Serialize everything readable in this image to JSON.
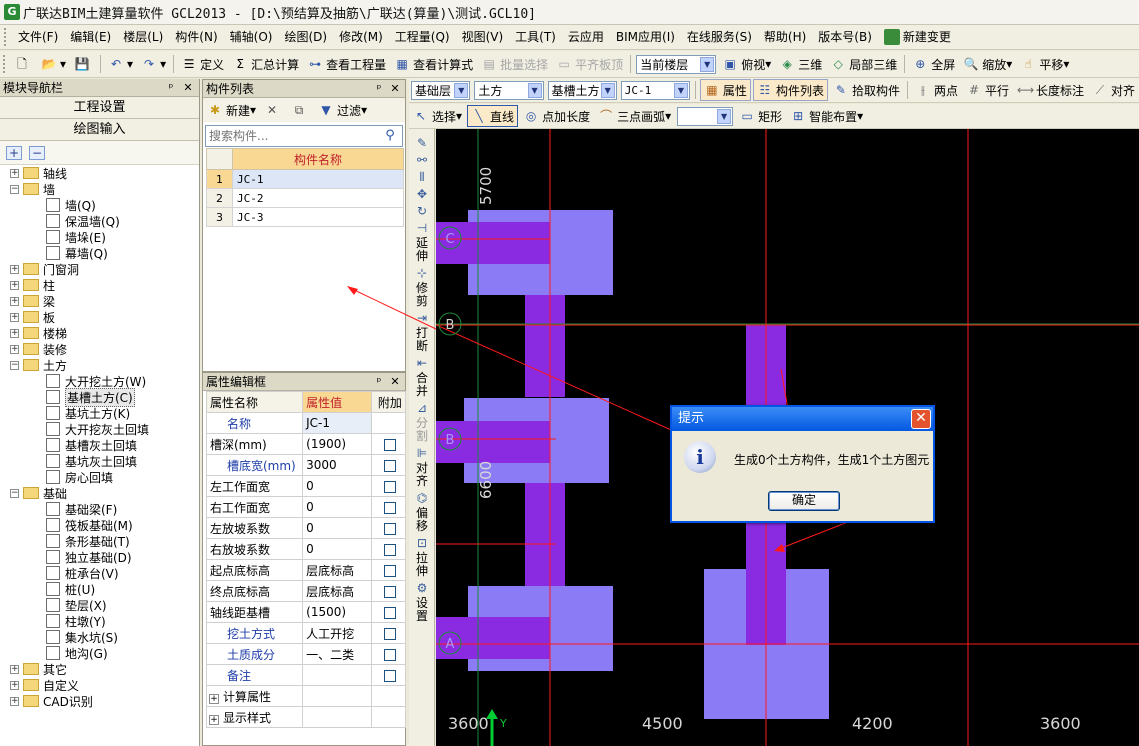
{
  "window": {
    "title": "广联达BIM土建算量软件 GCL2013 - [D:\\预结算及抽筋\\广联达(算量)\\测试.GCL10]"
  },
  "menu": [
    "文件(F)",
    "编辑(E)",
    "楼层(L)",
    "构件(N)",
    "辅轴(O)",
    "绘图(D)",
    "修改(M)",
    "工程量(Q)",
    "视图(V)",
    "工具(T)",
    "云应用",
    "BIM应用(I)",
    "在线服务(S)",
    "帮助(H)",
    "版本号(B)",
    "新建变更"
  ],
  "toolbar1": {
    "define": "定义",
    "summary": "汇总计算",
    "view_qty": "查看工程量",
    "view_formula": "查看计算式",
    "batch_select": "批量选择",
    "flat_top": "平齐板顶",
    "floor_select": "当前楼层",
    "view_mode": "俯视",
    "three_d": "三维",
    "local_3d": "局部三维",
    "fullscreen": "全屏",
    "zoom": "缩放",
    "pan": "平移"
  },
  "toolbar2": {
    "layer": "基础层",
    "type": "土方",
    "subtype": "基槽土方",
    "component": "JC-1",
    "props": "属性",
    "comp_list": "构件列表",
    "pick": "拾取构件",
    "two_point": "两点",
    "parallel": "平行",
    "length_dim": "长度标注",
    "align": "对齐"
  },
  "toolbar3": {
    "select": "选择",
    "line": "直线",
    "point_len": "点加长度",
    "arc3": "三点画弧",
    "rect": "矩形",
    "smart": "智能布置"
  },
  "nav": {
    "title": "模块导航栏",
    "project_setup": "工程设置",
    "drawing_input": "绘图输入",
    "tree": [
      {
        "label": "轴线",
        "level": 0,
        "kind": "folder",
        "exp": "+"
      },
      {
        "label": "墙",
        "level": 0,
        "kind": "folder",
        "exp": "-"
      },
      {
        "label": "墙(Q)",
        "level": 1,
        "kind": "leaf"
      },
      {
        "label": "保温墙(Q)",
        "level": 1,
        "kind": "leaf"
      },
      {
        "label": "墙垛(E)",
        "level": 1,
        "kind": "leaf"
      },
      {
        "label": "幕墙(Q)",
        "level": 1,
        "kind": "leaf"
      },
      {
        "label": "门窗洞",
        "level": 0,
        "kind": "folder",
        "exp": "+"
      },
      {
        "label": "柱",
        "level": 0,
        "kind": "folder",
        "exp": "+"
      },
      {
        "label": "梁",
        "level": 0,
        "kind": "folder",
        "exp": "+"
      },
      {
        "label": "板",
        "level": 0,
        "kind": "folder",
        "exp": "+"
      },
      {
        "label": "楼梯",
        "level": 0,
        "kind": "folder",
        "exp": "+"
      },
      {
        "label": "装修",
        "level": 0,
        "kind": "folder",
        "exp": "+"
      },
      {
        "label": "土方",
        "level": 0,
        "kind": "folder",
        "exp": "-"
      },
      {
        "label": "大开挖土方(W)",
        "level": 1,
        "kind": "leaf"
      },
      {
        "label": "基槽土方(C)",
        "level": 1,
        "kind": "leaf",
        "selected": true
      },
      {
        "label": "基坑土方(K)",
        "level": 1,
        "kind": "leaf"
      },
      {
        "label": "大开挖灰土回填",
        "level": 1,
        "kind": "leaf"
      },
      {
        "label": "基槽灰土回填",
        "level": 1,
        "kind": "leaf"
      },
      {
        "label": "基坑灰土回填",
        "level": 1,
        "kind": "leaf"
      },
      {
        "label": "房心回填",
        "level": 1,
        "kind": "leaf"
      },
      {
        "label": "基础",
        "level": 0,
        "kind": "folder",
        "exp": "-"
      },
      {
        "label": "基础梁(F)",
        "level": 1,
        "kind": "leaf"
      },
      {
        "label": "筏板基础(M)",
        "level": 1,
        "kind": "leaf"
      },
      {
        "label": "条形基础(T)",
        "level": 1,
        "kind": "leaf"
      },
      {
        "label": "独立基础(D)",
        "level": 1,
        "kind": "leaf"
      },
      {
        "label": "桩承台(V)",
        "level": 1,
        "kind": "leaf"
      },
      {
        "label": "桩(U)",
        "level": 1,
        "kind": "leaf"
      },
      {
        "label": "垫层(X)",
        "level": 1,
        "kind": "leaf"
      },
      {
        "label": "柱墩(Y)",
        "level": 1,
        "kind": "leaf"
      },
      {
        "label": "集水坑(S)",
        "level": 1,
        "kind": "leaf"
      },
      {
        "label": "地沟(G)",
        "level": 1,
        "kind": "leaf"
      },
      {
        "label": "其它",
        "level": 0,
        "kind": "folder",
        "exp": "+"
      },
      {
        "label": "自定义",
        "level": 0,
        "kind": "folder",
        "exp": "+"
      },
      {
        "label": "CAD识别",
        "level": 0,
        "kind": "folder",
        "exp": "+"
      }
    ]
  },
  "plist": {
    "title": "构件列表",
    "new": "新建",
    "filter": "过滤",
    "search_placeholder": "搜索构件...",
    "col": "构件名称",
    "rows": [
      {
        "n": "1",
        "name": "JC-1"
      },
      {
        "n": "2",
        "name": "JC-2"
      },
      {
        "n": "3",
        "name": "JC-3"
      }
    ]
  },
  "props": {
    "title": "属性编辑框",
    "headers": {
      "name": "属性名称",
      "value": "属性值",
      "extra": "附加"
    },
    "rows": [
      {
        "k": "名称",
        "v": "JC-1",
        "blue": true,
        "cb": false
      },
      {
        "k": "槽深(mm)",
        "v": "(1900)",
        "blue": false,
        "cb": true
      },
      {
        "k": "槽底宽(mm)",
        "v": "3000",
        "blue": true,
        "cb": true
      },
      {
        "k": "左工作面宽",
        "v": "0",
        "blue": false,
        "cb": true
      },
      {
        "k": "右工作面宽",
        "v": "0",
        "blue": false,
        "cb": true
      },
      {
        "k": "左放坡系数",
        "v": "0",
        "blue": false,
        "cb": true
      },
      {
        "k": "右放坡系数",
        "v": "0",
        "blue": false,
        "cb": true
      },
      {
        "k": "起点底标高",
        "v": "层底标高",
        "blue": false,
        "cb": true
      },
      {
        "k": "终点底标高",
        "v": "层底标高",
        "blue": false,
        "cb": true
      },
      {
        "k": "轴线距基槽",
        "v": "(1500)",
        "blue": false,
        "cb": true
      },
      {
        "k": "挖土方式",
        "v": "人工开挖",
        "blue": true,
        "cb": true
      },
      {
        "k": "土质成分",
        "v": "一、二类",
        "blue": true,
        "cb": true
      },
      {
        "k": "备注",
        "v": "",
        "blue": true,
        "cb": true
      }
    ],
    "groups": [
      "计算属性",
      "显示样式"
    ]
  },
  "vtools": [
    "延伸",
    "修剪",
    "打断",
    "合并",
    "分割",
    "对齐",
    "偏移",
    "拉伸",
    "设置"
  ],
  "canvas": {
    "axis_labels": [
      "C",
      "B",
      "B",
      "A"
    ],
    "dims_bottom": [
      "3600",
      "4500",
      "4200",
      "3600"
    ],
    "dims_side": [
      "5700",
      "6600"
    ],
    "colors": {
      "purple": "#8a2be2",
      "light_purple": "#8b7cf5",
      "red_line": "#ff1a1a",
      "green_line": "#1d8a3a"
    }
  },
  "dialog": {
    "title": "提示",
    "message": "生成0个土方构件，生成1个土方图元",
    "ok": "确定"
  }
}
